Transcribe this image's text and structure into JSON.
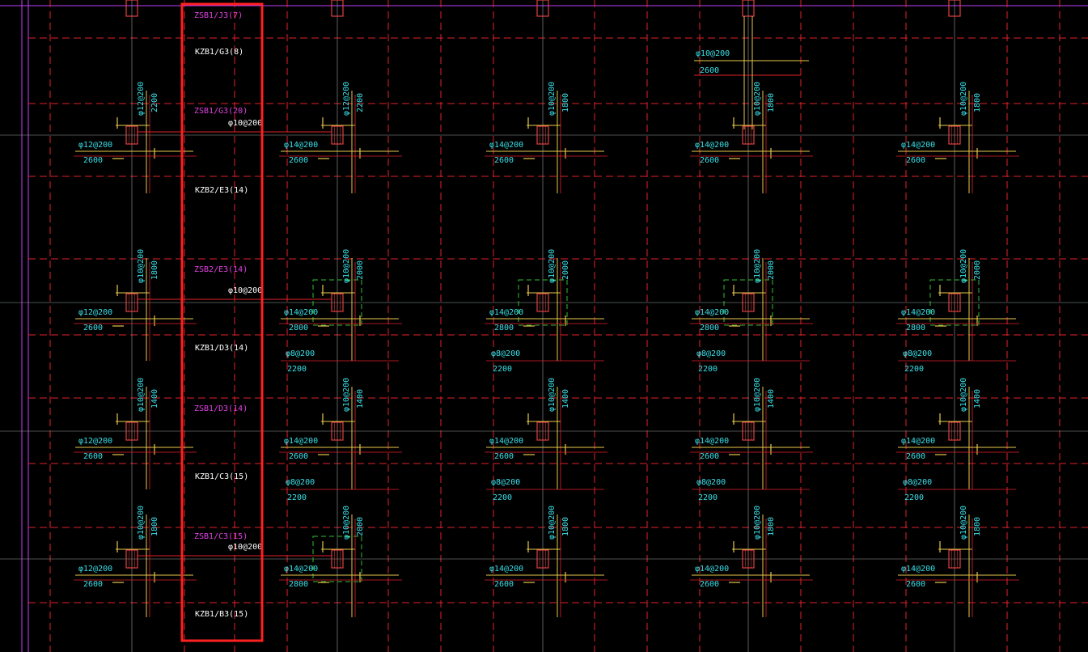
{
  "colors": {
    "background": "#000000",
    "grid_dashed": "#e0222a",
    "axis": "#9aa0a0",
    "boundary": "#c040ff",
    "rebar_text": "#38e0e8",
    "leader": "#e8c84a",
    "band_text": "#ffffff",
    "strip_text": "#e040e0",
    "highlight": "#ff2020",
    "column": "#e04040",
    "green_box": "#30c030"
  },
  "band_labels": [
    {
      "text": "ZSB1/J3(7)",
      "kind": "strip"
    },
    {
      "text": "KZB1/G3(8)",
      "kind": "band"
    },
    {
      "text": "ZSB1/G3(20)",
      "kind": "strip"
    },
    {
      "text": "KZB2/E3(14)",
      "kind": "band"
    },
    {
      "text": "ZSB2/E3(14)",
      "kind": "strip"
    },
    {
      "text": "KZB1/D3(14)",
      "kind": "band"
    },
    {
      "text": "ZSB1/D3(14)",
      "kind": "strip"
    },
    {
      "text": "KZB1/C3(15)",
      "kind": "band"
    },
    {
      "text": "ZSB1/C3(15)",
      "kind": "strip"
    },
    {
      "text": "KZB1/B3(15)",
      "kind": "band"
    }
  ],
  "connector_labels": [
    "φ10@200",
    "φ10@200",
    "φ10@200"
  ],
  "top_note": {
    "spec": "φ10@200",
    "length": "2600"
  },
  "rows": [
    {
      "cols": [
        {
          "vspec": "φ12@200",
          "vlen": "2200",
          "hspec": "φ12@200",
          "hlen": "2600"
        },
        {
          "vspec": "φ12@200",
          "vlen": "2200",
          "hspec": "φ14@200",
          "hlen": "2600"
        },
        {
          "vspec": "φ10@200",
          "vlen": "1800",
          "hspec": "φ14@200",
          "hlen": "2600"
        },
        {
          "vspec": "φ10@200",
          "vlen": "1800",
          "hspec": "φ14@200",
          "hlen": "2600"
        },
        {
          "vspec": "φ10@200",
          "vlen": "1800",
          "hspec": "φ14@200",
          "hlen": "2600"
        }
      ]
    },
    {
      "cols": [
        {
          "vspec": "φ10@200",
          "vlen": "1800",
          "hspec": "φ12@200",
          "hlen": "2600"
        },
        {
          "vspec": "φ10@200",
          "vlen": "2000",
          "hspec": "φ14@200",
          "hlen": "2800",
          "bspec": "φ8@200",
          "blen": "2200"
        },
        {
          "vspec": "φ10@200",
          "vlen": "2000",
          "hspec": "φ14@200",
          "hlen": "2800",
          "bspec": "φ8@200",
          "blen": "2200"
        },
        {
          "vspec": "φ10@200",
          "vlen": "2000",
          "hspec": "φ14@200",
          "hlen": "2800",
          "bspec": "φ8@200",
          "blen": "2200"
        },
        {
          "vspec": "φ10@200",
          "vlen": "2000",
          "hspec": "φ14@200",
          "hlen": "2800",
          "bspec": "φ8@200",
          "blen": "2200"
        }
      ]
    },
    {
      "cols": [
        {
          "vspec": "φ10@200",
          "vlen": "1400",
          "hspec": "φ12@200",
          "hlen": "2600"
        },
        {
          "vspec": "φ10@200",
          "vlen": "1400",
          "hspec": "φ14@200",
          "hlen": "2600",
          "bspec": "φ8@200",
          "blen": "2200"
        },
        {
          "vspec": "φ10@200",
          "vlen": "1400",
          "hspec": "φ14@200",
          "hlen": "2600",
          "bspec": "φ8@200",
          "blen": "2200"
        },
        {
          "vspec": "φ10@200",
          "vlen": "1400",
          "hspec": "φ14@200",
          "hlen": "2600",
          "bspec": "φ8@200",
          "blen": "2200"
        },
        {
          "vspec": "φ10@200",
          "vlen": "1400",
          "hspec": "φ14@200",
          "hlen": "2600",
          "bspec": "φ8@200",
          "blen": "2200"
        }
      ]
    },
    {
      "cols": [
        {
          "vspec": "φ10@200",
          "vlen": "1800",
          "hspec": "φ12@200",
          "hlen": "2600"
        },
        {
          "vspec": "φ10@200",
          "vlen": "2000",
          "hspec": "φ14@200",
          "hlen": "2800"
        },
        {
          "vspec": "φ10@200",
          "vlen": "1800",
          "hspec": "φ14@200",
          "hlen": "2600"
        },
        {
          "vspec": "φ10@200",
          "vlen": "1800",
          "hspec": "φ14@200",
          "hlen": "2600"
        },
        {
          "vspec": "φ10@200",
          "vlen": "1800",
          "hspec": "φ14@200",
          "hlen": "2600"
        }
      ]
    }
  ]
}
